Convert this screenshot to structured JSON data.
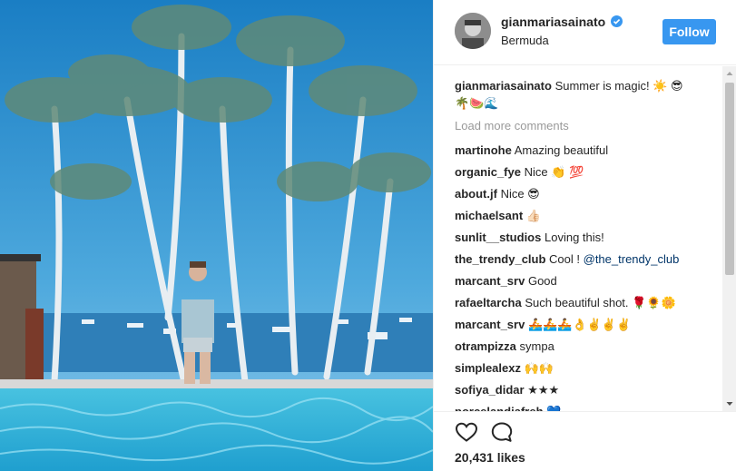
{
  "post": {
    "username": "gianmariasainato",
    "location": "Bermuda",
    "follow_label": "Follow",
    "likes": "20,431 likes"
  },
  "caption": {
    "username": "gianmariasainato",
    "text": "Summer is magic! ☀️ 😎",
    "text_line2": "🌴🍉🌊"
  },
  "load_more": "Load more comments",
  "comments": [
    {
      "username": "martinohe",
      "text": "Amazing beautiful"
    },
    {
      "username": "organic_fye",
      "text": "Nice 👏 💯"
    },
    {
      "username": "about.jf",
      "text": "Nice 😎"
    },
    {
      "username": "michaelsant",
      "text": "👍🏻"
    },
    {
      "username": "sunlit__studios",
      "text": "Loving this!"
    },
    {
      "username": "the_trendy_club",
      "text": "Cool ! ",
      "mention": "@the_trendy_club"
    },
    {
      "username": "marcant_srv",
      "text": "Good"
    },
    {
      "username": "rafaeltarcha",
      "text": "Such beautiful shot. 🌹🌻🌼"
    },
    {
      "username": "marcant_srv",
      "text": "🚣🚣🚣👌✌️✌️✌️"
    },
    {
      "username": "otrampizza",
      "text": "sympa"
    },
    {
      "username": "simplealexz",
      "text": "🙌🙌"
    },
    {
      "username": "sofiya_didar",
      "text": "★★★"
    },
    {
      "username": "porcelandiafreh",
      "text": "💙"
    }
  ],
  "icons": {
    "verified": "verified-badge-icon",
    "like": "heart-icon",
    "comment": "comment-bubble-icon"
  },
  "colors": {
    "accent": "#3897f0",
    "text": "#262626",
    "muted": "#999999",
    "mention": "#003569"
  }
}
